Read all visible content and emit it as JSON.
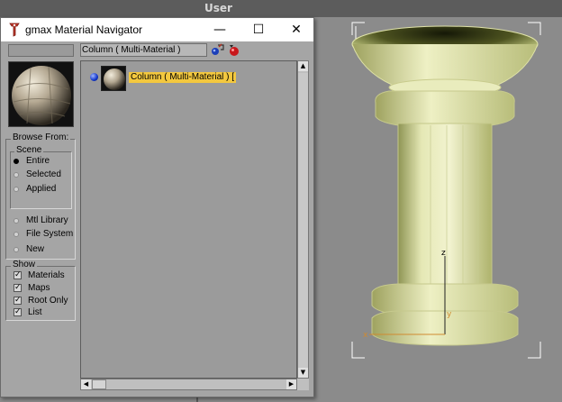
{
  "viewport": {
    "label": "User"
  },
  "dialog": {
    "title": "gmax Material Navigator",
    "controls": {
      "minimize": "—",
      "maximize": "☐",
      "close": "✕"
    },
    "material_name": "Column  ( Multi-Material )"
  },
  "browse": {
    "title": "Browse From:",
    "scene_title": "Scene",
    "scene_options": [
      "Entire",
      "Selected",
      "Applied"
    ],
    "other_options": [
      "Mtl Library",
      "File System",
      "New"
    ],
    "selected": "Entire"
  },
  "show": {
    "title": "Show",
    "items": [
      {
        "label": "Materials",
        "checked": true
      },
      {
        "label": "Maps",
        "checked": true
      },
      {
        "label": "Root Only",
        "checked": true
      },
      {
        "label": "List",
        "checked": true
      }
    ]
  },
  "tree": {
    "item_label": "Column  ( Multi-Material )  ["
  },
  "scroll": {
    "up": "▲",
    "down": "▼",
    "left": "◀",
    "right": "▶"
  },
  "icons": {
    "app": "gmax-logo-icon",
    "assign": "assign-material-icon",
    "get_material": "get-material-icon"
  },
  "colors": {
    "selection": "#f3c83f",
    "panel": "#a5a5a5",
    "viewport_bg": "#8b8b8b"
  }
}
